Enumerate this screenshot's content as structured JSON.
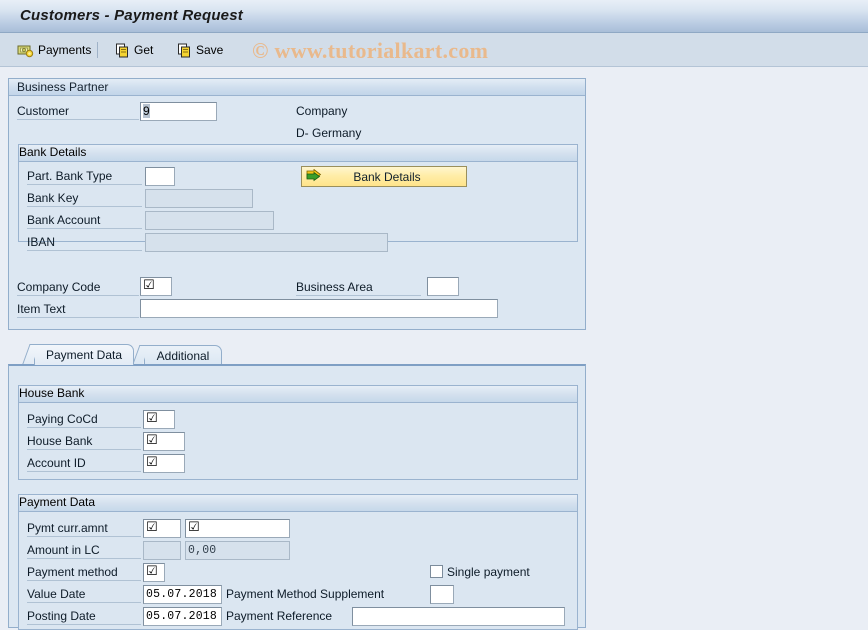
{
  "window": {
    "title": "Customers - Payment Request"
  },
  "toolbar": {
    "payments_label": "Payments",
    "payments_icon": "money-icon",
    "get_label": "Get",
    "get_icon": "copy-document-icon",
    "save_label": "Save",
    "save_icon": "copy-document-icon",
    "watermark": "© www.tutorialkart.com"
  },
  "business_partner": {
    "title": "Business Partner",
    "customer_label": "Customer",
    "customer_value": "9",
    "company_label": "Company",
    "company_value": "D- Germany",
    "bank_details": {
      "title": "Bank Details",
      "part_bank_type_label": "Part. Bank Type",
      "part_bank_type_value": "",
      "bank_key_label": "Bank Key",
      "bank_key_value": "",
      "bank_account_label": "Bank Account",
      "bank_account_value": "",
      "iban_label": "IBAN",
      "iban_value": "",
      "button_label": "Bank Details",
      "button_icon": "green-arrow-icon"
    },
    "company_code_label": "Company Code",
    "company_code_value": "☑",
    "business_area_label": "Business Area",
    "business_area_value": "",
    "item_text_label": "Item Text",
    "item_text_value": ""
  },
  "tabs": [
    {
      "label": "Payment Data",
      "active": true
    },
    {
      "label": "Additional",
      "active": false
    }
  ],
  "house_bank": {
    "title": "House Bank",
    "paying_cocd_label": "Paying CoCd",
    "paying_cocd_value": "☑",
    "house_bank_label": "House Bank",
    "house_bank_value": "☑",
    "account_id_label": "Account ID",
    "account_id_value": "☑"
  },
  "payment_data": {
    "title": "Payment Data",
    "pymt_curr_amnt_label": "Pymt curr.amnt",
    "pymt_curr_value": "☑",
    "pymt_amnt_value": "☑",
    "amount_in_lc_label": "Amount in LC",
    "amount_in_lc_curr": "",
    "amount_in_lc_value": "0,00",
    "payment_method_label": "Payment method",
    "payment_method_value": "☑",
    "single_payment_label": "Single payment",
    "single_payment_checked": false,
    "value_date_label": "Value Date",
    "value_date_value": "05.07.2018",
    "payment_method_supplement_label": "Payment Method Supplement",
    "payment_method_supplement_value": "",
    "posting_date_label": "Posting Date",
    "posting_date_value": "05.07.2018",
    "payment_reference_label": "Payment Reference",
    "payment_reference_value": ""
  },
  "colors": {
    "page_background": "#eaeef5",
    "group_background": "#dce7f2",
    "titlebar_accent": "#a9bed8",
    "button_yellow": "#ffe48a",
    "watermark": "#e9b98c",
    "field_disabled": "#d6e1ec"
  }
}
